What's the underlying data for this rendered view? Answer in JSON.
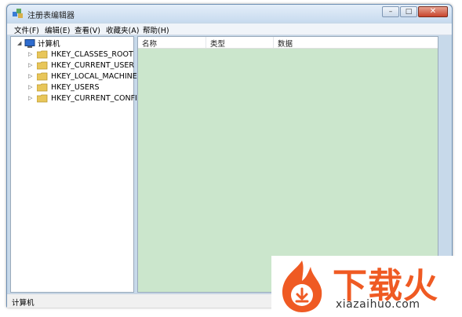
{
  "window": {
    "title": "注册表编辑器"
  },
  "menu": [
    "文件(F)",
    "编辑(E)",
    "查看(V)",
    "收藏夹(A)",
    "帮助(H)"
  ],
  "tree": {
    "root": "计算机",
    "children": [
      "HKEY_CLASSES_ROOT",
      "HKEY_CURRENT_USER",
      "HKEY_LOCAL_MACHINE",
      "HKEY_USERS",
      "HKEY_CURRENT_CONFIG"
    ]
  },
  "list": {
    "columns": [
      "名称",
      "类型",
      "数据"
    ]
  },
  "status": {
    "text": "计算机"
  },
  "watermark": {
    "brand": "下载火",
    "url": "xiazaihuo.com"
  },
  "colors": {
    "list_background": "#cbe6cc",
    "watermark_orange": "#ef5a23"
  },
  "icons": {
    "app": "registry-editor-icon",
    "root": "computer-icon",
    "folder": "folder-icon",
    "window_controls": [
      "minimize-icon",
      "maximize-icon",
      "close-icon"
    ]
  }
}
